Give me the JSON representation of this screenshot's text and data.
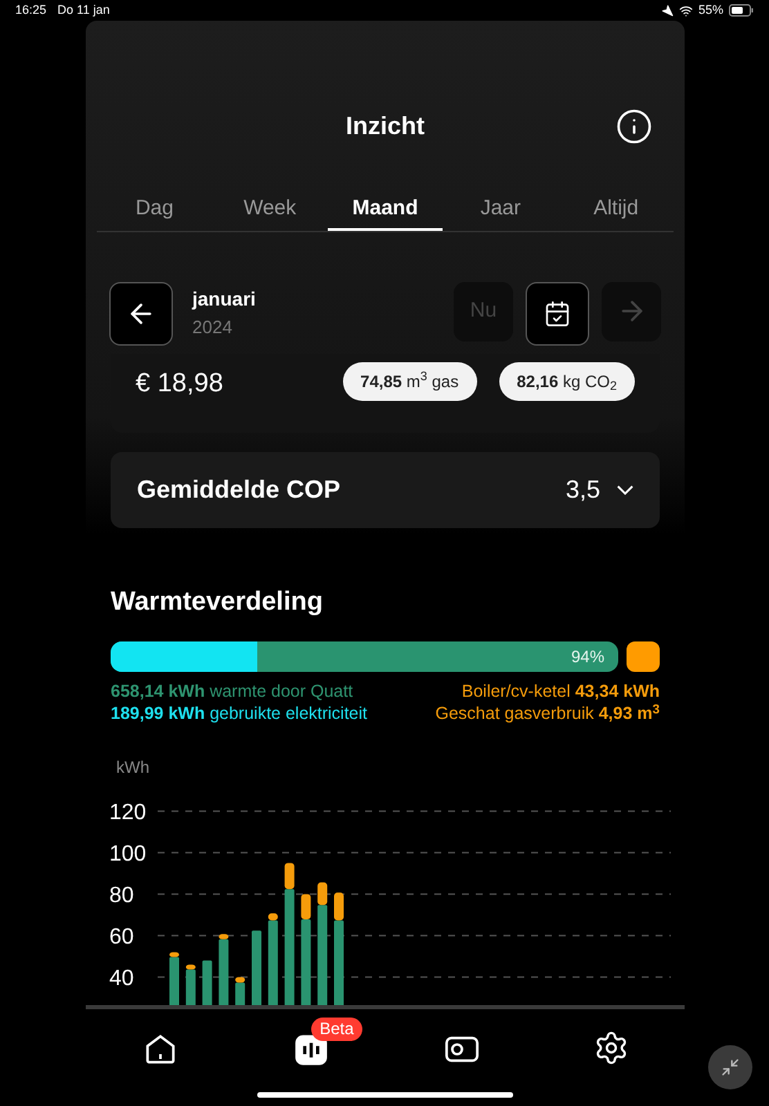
{
  "status_bar": {
    "time": "16:25",
    "date": "Do 11 jan",
    "battery": "55%"
  },
  "header": {
    "title": "Inzicht"
  },
  "tabs": [
    {
      "label": "Dag",
      "selected": false
    },
    {
      "label": "Week",
      "selected": false
    },
    {
      "label": "Maand",
      "selected": true
    },
    {
      "label": "Jaar",
      "selected": false
    },
    {
      "label": "Altijd",
      "selected": false
    }
  ],
  "period": {
    "month": "januari",
    "year": "2024",
    "now_button": "Nu",
    "now_disabled": true,
    "next_disabled": true
  },
  "cost_card": {
    "cost": "€ 18,98",
    "chips": [
      "**74,85** m$^{3}$ gas",
      "**82,16** kg CO$_{2}$"
    ]
  },
  "cop_card": {
    "label": "Gemiddelde COP",
    "value": "3,5",
    "expanded": false
  },
  "heat_distribution": {
    "title": "Warmteverdeling",
    "bar": {
      "level": 0.29,
      "label": "94%"
    },
    "legend_left": [
      {
        "text": "**658,14 kWh** warmte door Quatt",
        "color": "#2e9470"
      },
      {
        "text": "**189,99 kWh** gebruikte elektriciteit",
        "color": "#1ee0ee"
      }
    ],
    "legend_right": [
      {
        "text": "Boiler/cv-ketel **43,34 kWh**",
        "color": "#f59c0b"
      },
      {
        "text": "Geschat gasverbruik **4,93 m$^{3}$**",
        "color": "#f59c0b"
      }
    ]
  },
  "chart_data": {
    "type": "bar",
    "ylabel": "kWh",
    "stacked": true,
    "grid": true,
    "ylim": [
      0,
      120
    ],
    "yticks": [
      40,
      60,
      80,
      100,
      120
    ],
    "series": [
      {
        "color": "#2a9470",
        "values": [
          49.6,
          43.6,
          48,
          58.2,
          37.3,
          62.4,
          67.3,
          82.4,
          67.8,
          74.7,
          67.3
        ]
      },
      {
        "color": "#f59c0b",
        "values": [
          2.4,
          2.4,
          0,
          2.5,
          2.7,
          0,
          3.4,
          12.6,
          12.2,
          10.9,
          13.4
        ]
      }
    ]
  },
  "nav": [
    {
      "kind": "home",
      "selected": false
    },
    {
      "kind": "insight",
      "selected": true,
      "badge": "Beta"
    },
    {
      "kind": "device",
      "selected": false
    },
    {
      "kind": "settings",
      "selected": false
    }
  ]
}
